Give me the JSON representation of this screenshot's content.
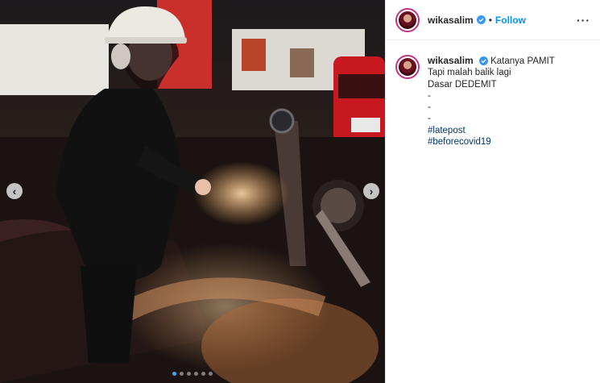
{
  "post": {
    "username": "wikasalim",
    "follow_label": "Follow",
    "separator": "•",
    "more_label": "···",
    "caption": {
      "first_line": "Katanya PAMIT",
      "lines": [
        "Tapi malah balik lagi",
        "Dasar DEDEMIT",
        "-",
        "-",
        "-"
      ],
      "hashtags": [
        "#latepost",
        "#beforecovid19"
      ]
    }
  },
  "carousel": {
    "prev_icon": "‹",
    "next_icon": "›",
    "slide_count": 6,
    "active_slide": 1
  },
  "colors": {
    "follow": "#0095f6",
    "hashtag": "#00376b",
    "verified": "#3897f0",
    "active_dot": "#4aa3f0"
  },
  "icons": {
    "verified": "verified-badge-icon",
    "more": "more-options-icon",
    "prev": "chevron-left-icon",
    "next": "chevron-right-icon"
  }
}
